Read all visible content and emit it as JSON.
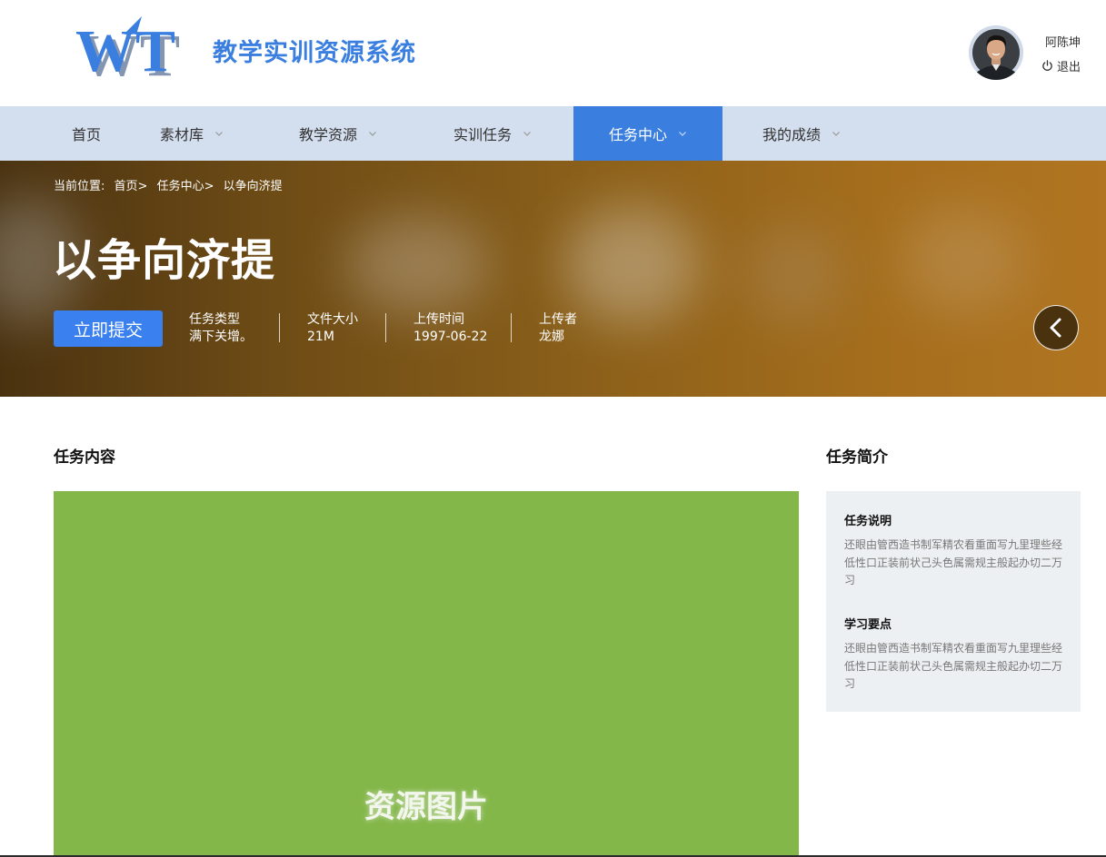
{
  "header": {
    "logo_text": "WT",
    "site_title": "教学实训资源系统",
    "user_name": "阿陈坤",
    "logout_label": "退出"
  },
  "nav": {
    "items": [
      {
        "label": "首页",
        "has_dropdown": false,
        "active": false
      },
      {
        "label": "素材库",
        "has_dropdown": true,
        "active": false
      },
      {
        "label": "教学资源",
        "has_dropdown": true,
        "active": false
      },
      {
        "label": "实训任务",
        "has_dropdown": true,
        "active": false
      },
      {
        "label": "任务中心",
        "has_dropdown": true,
        "active": true
      },
      {
        "label": "我的成绩",
        "has_dropdown": true,
        "active": false
      }
    ]
  },
  "banner": {
    "breadcrumb_label": "当前位置:",
    "breadcrumb": [
      "首页>",
      "任务中心>",
      "以争向济提"
    ],
    "title": "以争向济提",
    "submit_label": "立即提交",
    "meta": [
      {
        "label": "任务类型",
        "value": "满下关增。"
      },
      {
        "label": "文件大小",
        "value": "21M"
      },
      {
        "label": "上传时间",
        "value": "1997-06-22"
      },
      {
        "label": "上传者",
        "value": "龙娜"
      }
    ]
  },
  "main": {
    "content_title": "任务内容",
    "image_label": "资源图片",
    "intro_title": "任务简介",
    "intro": {
      "desc_heading": "任务说明",
      "desc_text": "还眼由管西造书制军精农看重面写九里理些经低性口正装前状己头色属需规主般起办切二万习",
      "points_heading": "学习要点",
      "points_text": "还眼由管西造书制军精农看重面写九里理些经低性口正装前状己头色属需规主般起办切二万习"
    }
  },
  "colors": {
    "brand_blue": "#3a7fe0",
    "nav_bg": "#d3deee",
    "image_placeholder": "#84b74a",
    "side_card_bg": "#edf0f2"
  }
}
